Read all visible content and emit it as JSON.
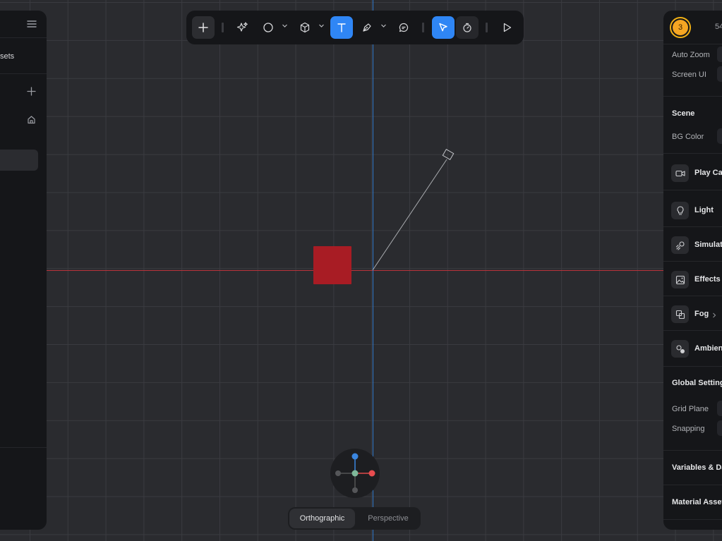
{
  "left_panel": {
    "partial_tab_label": "sets",
    "icons": [
      "menu-icon",
      "plus-icon",
      "home-icon"
    ]
  },
  "toolbar": {
    "buttons": [
      "add",
      "ai-sparkle",
      "shape-circle",
      "object-cube",
      "text",
      "pen",
      "comment",
      "select",
      "rotate",
      "play"
    ],
    "active": [
      "text",
      "select"
    ]
  },
  "view": {
    "orthographic_label": "Orthographic",
    "perspective_label": "Perspective",
    "selected": "Orthographic"
  },
  "right_panel": {
    "avatar_number": "3",
    "count_partial": "54",
    "auto_zoom_label": "Auto Zoom",
    "screen_ui_label": "Screen UI",
    "scene_heading": "Scene",
    "bg_color_label": "BG Color",
    "items": {
      "play_camera": "Play Car",
      "light": "Light",
      "simulation": "Simulat",
      "effects": "Effects",
      "fog": "Fog",
      "ambient": "Ambien"
    },
    "global_settings_heading": "Global Setting",
    "grid_plane_label": "Grid Plane",
    "snapping_label": "Snapping",
    "variables_heading": "Variables & Da",
    "material_assets_heading": "Material Asset"
  },
  "colors": {
    "accent": "#2f86f5",
    "x_axis": "#b8333a",
    "y_axis": "#2f76c7",
    "cube": "#a81c24",
    "avatar": "#f5a623"
  }
}
